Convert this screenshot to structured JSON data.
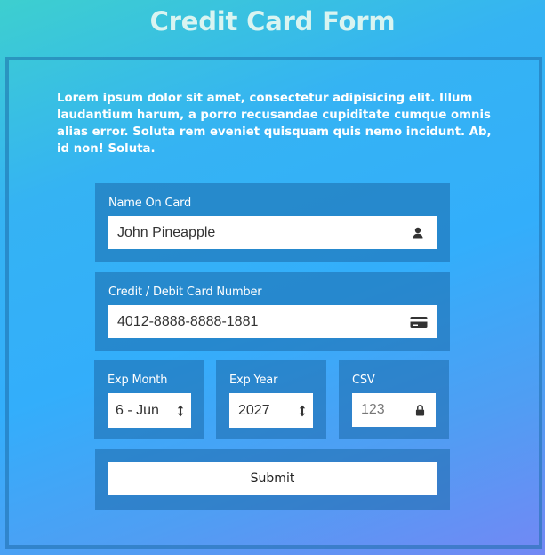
{
  "title": "Credit Card Form",
  "intro": "Lorem ipsum dolor sit amet, consectetur adipisicing elit. Illum laudantium harum, a porro recusandae cupiditate cumque omnis alias error. Soluta rem eveniet quisquam quis nemo incidunt. Ab, id non! Soluta.",
  "name": {
    "label": "Name On Card",
    "value": "John Pineapple",
    "icon": "user-icon"
  },
  "card_number": {
    "label": "Credit / Debit Card Number",
    "value": "4012-8888-8888-1881",
    "icon": "credit-card-icon"
  },
  "exp_month": {
    "label": "Exp Month",
    "value": "6 - Jun",
    "icon": "up-down-arrow-icon"
  },
  "exp_year": {
    "label": "Exp Year",
    "value": "2027",
    "icon": "up-down-arrow-icon"
  },
  "csv": {
    "label": "CSV",
    "placeholder": "123",
    "icon": "lock-icon"
  },
  "submit_label": "Submit"
}
